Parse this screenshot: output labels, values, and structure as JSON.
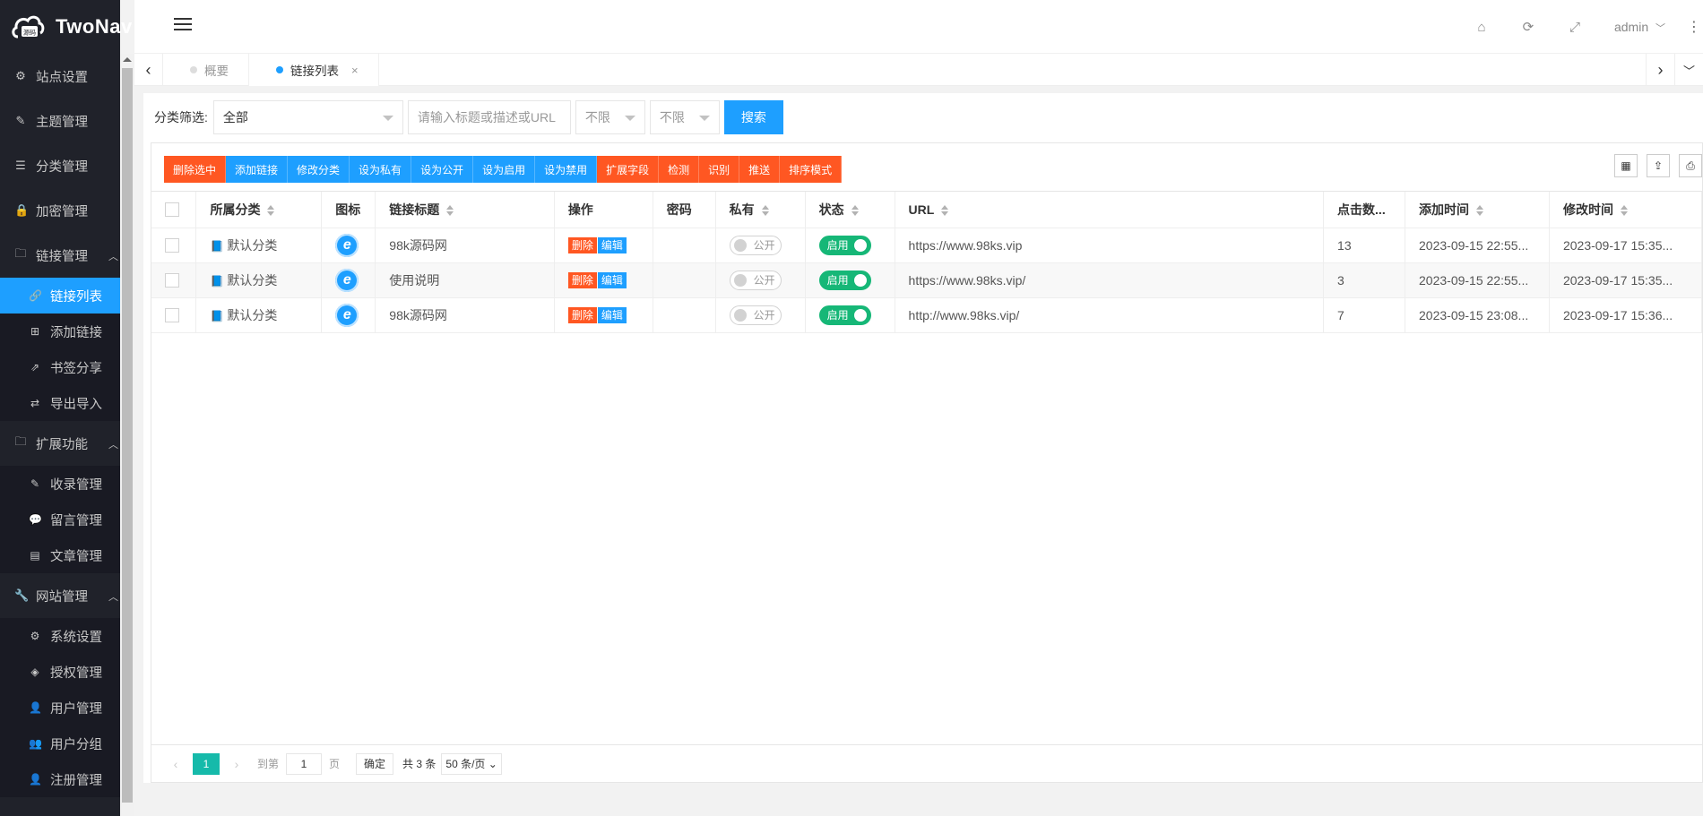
{
  "brand": {
    "name": "TwoNav",
    "mark_text": "源码"
  },
  "sidebar": {
    "items": [
      {
        "label": "站点设置",
        "icon": "gear-icon",
        "glyph": "⚙"
      },
      {
        "label": "主题管理",
        "icon": "brush-icon",
        "glyph": "✎"
      },
      {
        "label": "分类管理",
        "icon": "list-icon",
        "glyph": "☰"
      },
      {
        "label": "加密管理",
        "icon": "lock-icon",
        "glyph": "🔒"
      }
    ],
    "links_group": {
      "label": "链接管理",
      "glyph": "🗀",
      "children": [
        {
          "label": "链接列表",
          "glyph": "🔗"
        },
        {
          "label": "添加链接",
          "glyph": "⊞"
        },
        {
          "label": "书签分享",
          "glyph": "⇗"
        },
        {
          "label": "导出导入",
          "glyph": "⇄"
        }
      ]
    },
    "ext_group": {
      "label": "扩展功能",
      "glyph": "🗀",
      "children": [
        {
          "label": "收录管理",
          "glyph": "✎"
        },
        {
          "label": "留言管理",
          "glyph": "💬"
        },
        {
          "label": "文章管理",
          "glyph": "▤"
        }
      ]
    },
    "site_group": {
      "label": "网站管理",
      "glyph": "🔧",
      "children": [
        {
          "label": "系统设置",
          "glyph": "⚙"
        },
        {
          "label": "授权管理",
          "glyph": "◈"
        },
        {
          "label": "用户管理",
          "glyph": "👤"
        },
        {
          "label": "用户分组",
          "glyph": "👥"
        },
        {
          "label": "注册管理",
          "glyph": "👤"
        }
      ]
    }
  },
  "header": {
    "user": "admin",
    "icons": {
      "home": "⌂",
      "refresh": "⟳",
      "fullscreen": "⤢"
    },
    "user_caret": "﹀",
    "more": "⋮"
  },
  "tabbar": {
    "prev": "‹",
    "next": "›",
    "dropdown": "﹀",
    "tabs": [
      {
        "label": "概要"
      },
      {
        "label": "链接列表",
        "close": "×"
      }
    ]
  },
  "filter": {
    "label": "分类筛选:",
    "category_value": "全部",
    "search_placeholder": "请输入标题或描述或URL",
    "private_select": "不限",
    "status_select": "不限",
    "search_button": "搜索"
  },
  "toolbar": {
    "buttons": [
      "删除选中",
      "添加链接",
      "修改分类",
      "设为私有",
      "设为公开",
      "设为启用",
      "设为禁用",
      "扩展字段",
      "检测",
      "识别",
      "推送",
      "排序模式"
    ],
    "button_colors": [
      "#ff5722",
      "#1e9fff",
      "#1e9fff",
      "#1e9fff",
      "#1e9fff",
      "#1e9fff",
      "#1e9fff",
      "#ff5722",
      "#ff5722",
      "#ff5722",
      "#ff5722",
      "#ff5722"
    ],
    "right_icons": [
      {
        "name": "columns-icon",
        "glyph": "▦"
      },
      {
        "name": "export-icon",
        "glyph": "⇪"
      },
      {
        "name": "print-icon",
        "glyph": "⎙"
      }
    ]
  },
  "table": {
    "headers": [
      "所属分类",
      "图标",
      "链接标题",
      "操作",
      "密码",
      "私有",
      "状态",
      "URL",
      "点击数...",
      "添加时间",
      "修改时间"
    ],
    "delete_label": "删除",
    "edit_label": "编辑",
    "private_off_label": "公开",
    "status_on_label": "启用",
    "category_glyph": "📘",
    "icon_glyph": "e",
    "rows": [
      {
        "category": "默认分类",
        "title": "98k源码网",
        "password": "",
        "url": "https://www.98ks.vip",
        "clicks": "13",
        "added": "2023-09-15 22:55...",
        "modified": "2023-09-17 15:35..."
      },
      {
        "category": "默认分类",
        "title": "使用说明",
        "password": "",
        "url": "https://www.98ks.vip/",
        "clicks": "3",
        "added": "2023-09-15 22:55...",
        "modified": "2023-09-17 15:35..."
      },
      {
        "category": "默认分类",
        "title": "98k源码网",
        "password": "",
        "url": "http://www.98ks.vip/",
        "clicks": "7",
        "added": "2023-09-15 23:08...",
        "modified": "2023-09-17 15:36..."
      }
    ]
  },
  "pager": {
    "prev": "‹",
    "next": "›",
    "current": "1",
    "goto_label": "到第",
    "goto_value": "1",
    "page_label": "页",
    "confirm": "确定",
    "total": "共 3 条",
    "page_size": "50 条/页 ⌄"
  }
}
